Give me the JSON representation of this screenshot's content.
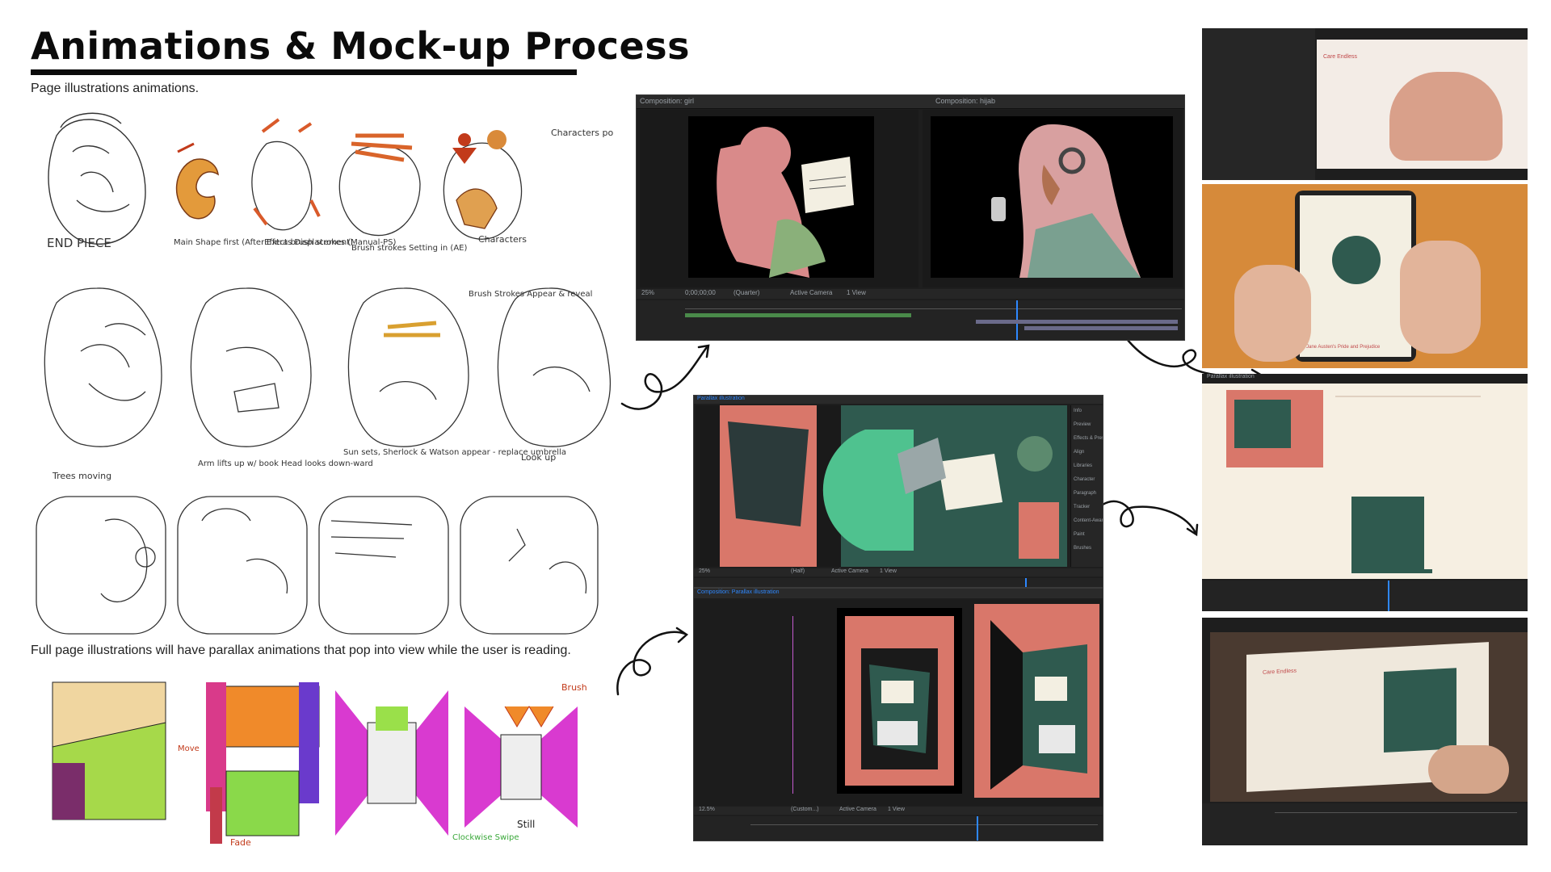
{
  "header": {
    "title": "Animations & Mock-up Process",
    "subtitle": "Page illustrations animations."
  },
  "caption": "Full page illustrations will have parallax animations that pop into view while the user is reading.",
  "sketch_labels": {
    "end_piece": "END PIECE",
    "main_shape": "Main Shape first (AfterEffects Displacement)",
    "extra_brush": "Extra brush strokes (Manual-PS)",
    "brush_strokes": "Brush strokes Setting in (AE)",
    "characters": "Characters",
    "characters_pop": "Characters pop-in",
    "brush_appear": "Brush Strokes Appear & reveal",
    "trees_moving": "Trees moving",
    "arm_lifts": "Arm lifts up w/ book Head looks down-ward",
    "sun_sets": "Sun sets, Sherlock & Watson appear - replace umbrella",
    "look_up": "Look up",
    "brush": "Brush",
    "still": "Still",
    "fade": "Fade",
    "move": "Move",
    "clockwise_swipe": "Clockwise Swipe"
  },
  "ae_window_1": {
    "panel_left_title": "Composition: girl",
    "panel_right_title": "Composition: hijab",
    "zoom": "25%",
    "quality": "(Quarter)",
    "camera": "Active Camera",
    "view": "1 View",
    "timecode": "0;00;00;00"
  },
  "ae_window_2": {
    "panel_title": "Parallax illustration",
    "zoom": "25%",
    "quality": "(Half)",
    "camera": "Active Camera",
    "view": "1 View",
    "sidebar_items": [
      "Info",
      "Preview",
      "Effects & Presets",
      "Align",
      "Libraries",
      "Character",
      "Paragraph",
      "Tracker",
      "Content-Aware Fill",
      "Paint",
      "Brushes"
    ]
  },
  "ae_window_3": {
    "panel_title": "Composition: Parallax illustration",
    "zoom": "12.5%",
    "quality": "(Custom...)",
    "camera": "Active Camera",
    "view": "1 View"
  },
  "mockups": [
    {
      "name": "tablet-hand-mockup",
      "caption": "Care Endless"
    },
    {
      "name": "tablet-held-mockup",
      "caption": "Jane Austen's Pride and Prejudice"
    },
    {
      "name": "web-layout-mockup",
      "caption": "Parallax illustration"
    },
    {
      "name": "laptop-mockup",
      "caption": "Care Endless"
    }
  ],
  "colors": {
    "coral": "#d9776a",
    "teal": "#2f5a4f",
    "mint": "#4fc28f",
    "ae_bg": "#1e1e1e",
    "ae_panel": "#2a2a2a",
    "ae_accent": "#2e88ff",
    "cream": "#f6efe2"
  }
}
